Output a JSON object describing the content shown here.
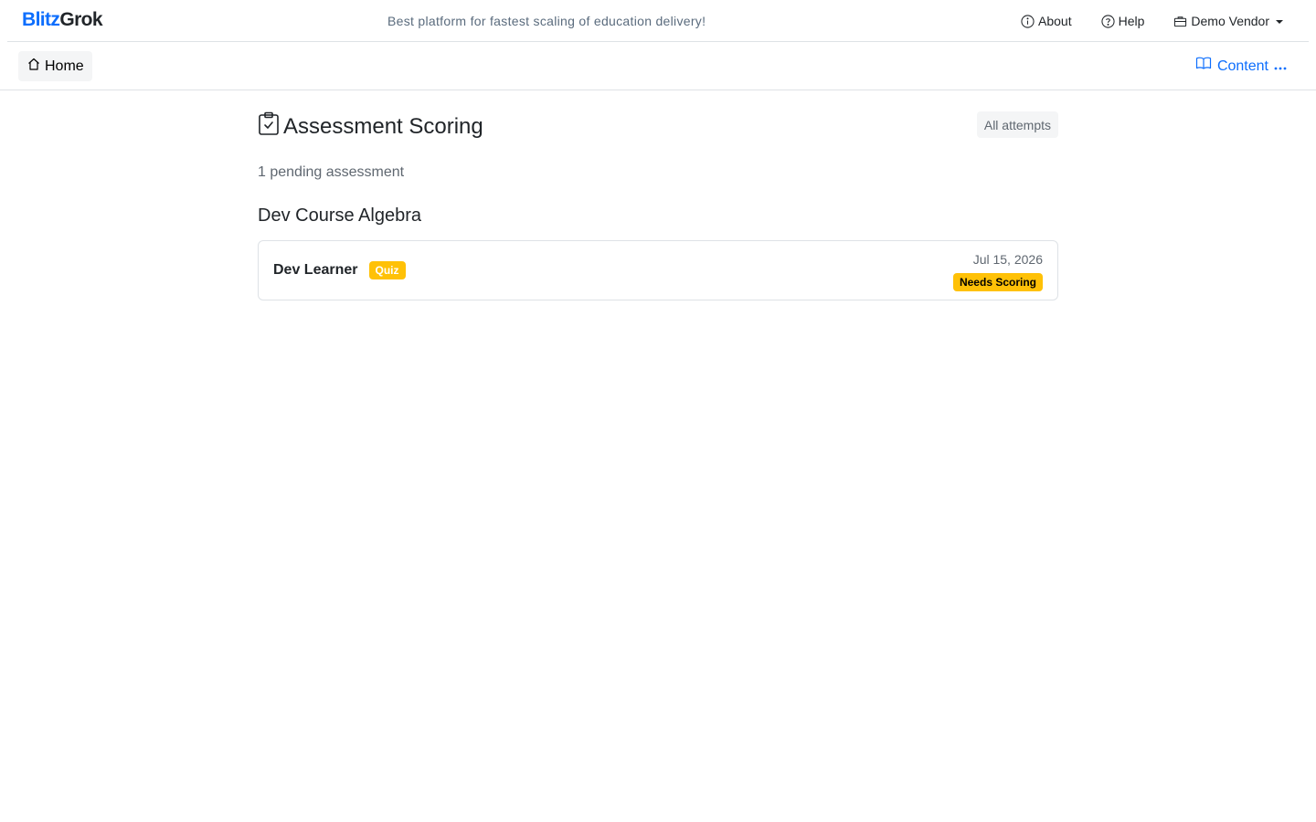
{
  "brand": {
    "part1": "Blitz",
    "part2": "Grok"
  },
  "tagline": "Best platform for fastest scaling of education delivery!",
  "topnav": {
    "about": "About",
    "help": "Help",
    "vendor": "Demo Vendor"
  },
  "subnav": {
    "home": "Home",
    "content": "Content"
  },
  "page": {
    "title": "Assessment Scoring",
    "all_attempts": "All attempts",
    "pending": "1 pending assessment",
    "course": "Dev Course Algebra",
    "card": {
      "learner": "Dev Learner",
      "type_badge": "Quiz",
      "date": "Jul 15, 2026",
      "status": "Needs Scoring"
    }
  },
  "colors": {
    "accent": "#0d6efd",
    "warning": "#ffc107"
  }
}
